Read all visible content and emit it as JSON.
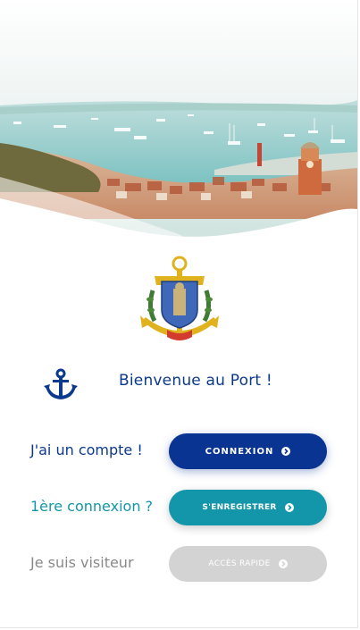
{
  "colors": {
    "primary": "#0a3491",
    "secondary": "#1496aa",
    "disabled": "#d3d3d3",
    "text_primary": "#0b3a8c",
    "text_secondary": "#1496a8",
    "text_muted": "#8a8a8a"
  },
  "header": {
    "hero_image": "port-panorama-image",
    "crest": "harbor-crest-logo"
  },
  "welcome": {
    "icon": "anchor-icon",
    "text": "Bienvenue au Port !"
  },
  "actions": [
    {
      "label": "J'ai un compte !",
      "button": "CONNEXION",
      "icon": "arrow-circle-right-icon"
    },
    {
      "label": "1ère connexion ?",
      "button": "S'ENREGISTRER",
      "icon": "arrow-circle-right-icon"
    },
    {
      "label": "Je suis visiteur",
      "button": "ACCÈS RAPIDE",
      "icon": "arrow-circle-right-icon"
    }
  ]
}
